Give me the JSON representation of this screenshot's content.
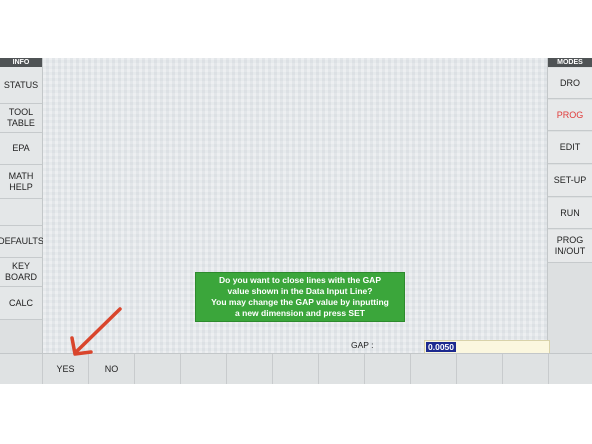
{
  "left_panel": {
    "header": "INFO",
    "buttons": [
      "STATUS",
      "TOOL\nTABLE",
      "EPA",
      "MATH\nHELP",
      "",
      "DEFAULTS",
      "KEY\nBOARD",
      "CALC"
    ]
  },
  "right_panel": {
    "header": "MODES",
    "buttons": [
      "DRO",
      "PROG",
      "EDIT",
      "SET-UP",
      "RUN",
      "PROG\nIN/OUT"
    ],
    "active": "PROG"
  },
  "dialog": {
    "lines": [
      "Do you want to close lines with the GAP",
      "value shown in the Data Input Line?",
      "You may change the GAP value by inputting",
      "a new dimension and press SET"
    ],
    "color": "#3ba63b"
  },
  "data_input": {
    "label": "GAP :",
    "value": "0.0050"
  },
  "soft_keys": [
    "YES",
    "NO",
    "",
    "",
    "",
    "",
    "",
    "",
    "",
    "",
    "",
    ""
  ],
  "annotation": {
    "icon": "red-arrow-icon",
    "color": "#d9452c"
  }
}
